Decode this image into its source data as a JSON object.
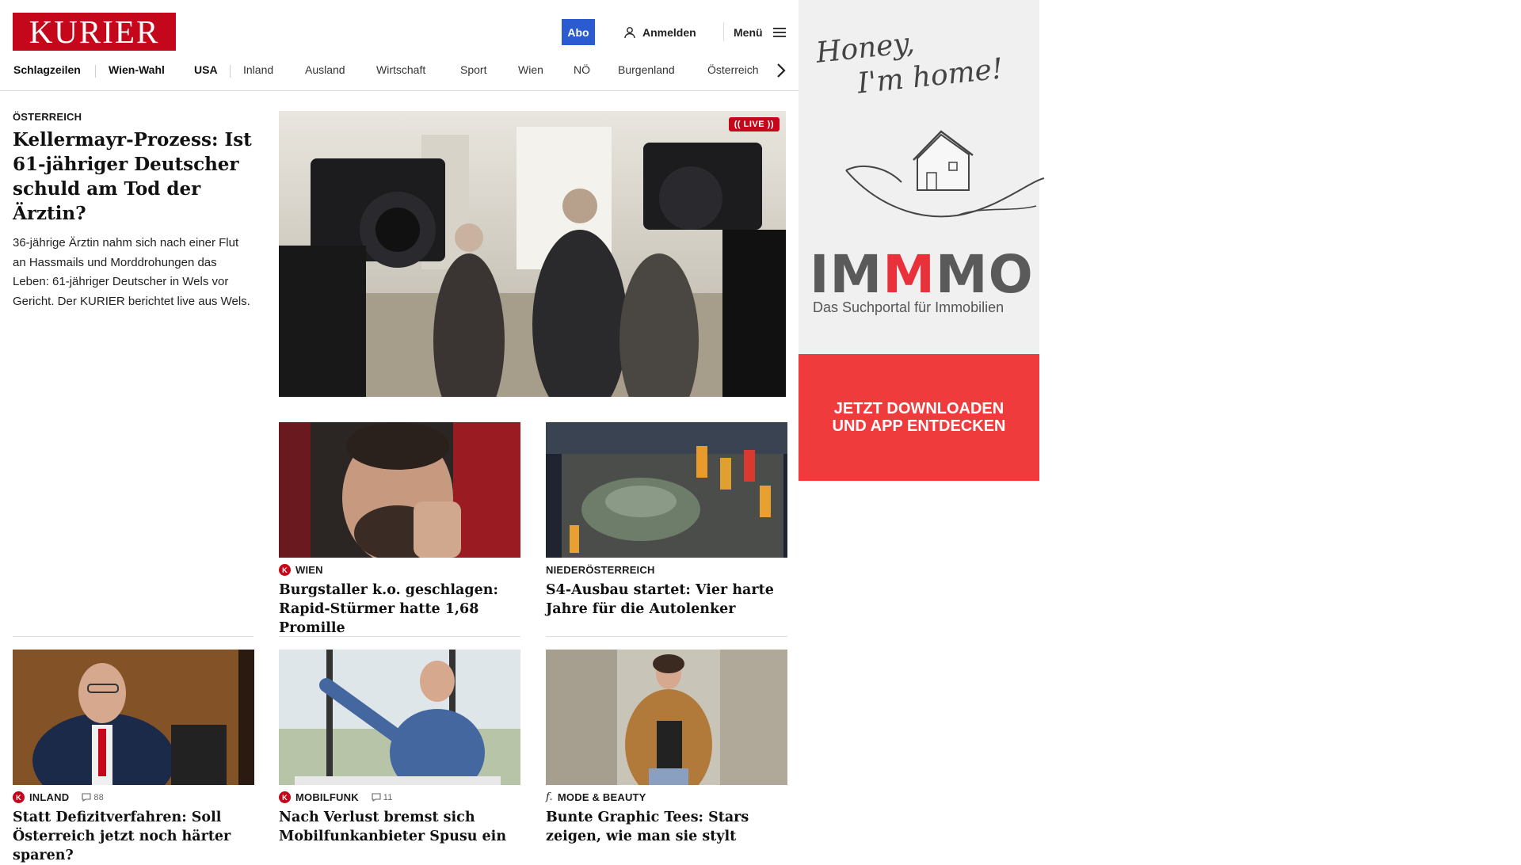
{
  "header": {
    "logo": "KURIER",
    "abo_label": "Abo",
    "login_label": "Anmelden",
    "menu_label": "Menü"
  },
  "nav": {
    "items": [
      "Schlagzeilen",
      "Wien-Wahl",
      "USA",
      "Inland",
      "Ausland",
      "Wirtschaft",
      "Sport",
      "Wien",
      "NÖ",
      "Burgenland",
      "Österreich"
    ]
  },
  "lead": {
    "kicker": "ÖSTERREICH",
    "headline": "Kellermayr-Prozess: Ist 61-jähriger Deutscher schuld am Tod der Ärztin?",
    "teaser": "36-jährige Ärztin nahm sich nach einer Flut an Hassmails und Morddrohungen das Leben: 61-jähriger Deutscher in Wels vor Gericht. Der KURIER berichtet live aus Wels.",
    "live_label": "LIVE"
  },
  "cards": [
    {
      "kicker": "WIEN",
      "headline": "Burgstaller k.o. geschlagen: Rapid-Stürmer hatte 1,68 Promille"
    },
    {
      "kicker": "NIEDERÖSTERREICH",
      "headline": "S4-Ausbau startet: Vier harte Jahre für die Autolenker"
    },
    {
      "kicker": "INLAND",
      "comments": "88",
      "headline": "Statt Defizitverfahren: Soll Österreich jetzt noch härter sparen?"
    },
    {
      "kicker": "MOBILFUNK",
      "comments": "11",
      "headline": "Nach Verlust bremst sich Mobilfunkanbieter Spusu ein"
    },
    {
      "kicker": "MODE & BEAUTY",
      "headline": "Bunte Graphic Tees: Stars zeigen, wie man sie stylt"
    }
  ],
  "ad": {
    "script_line1": "Honey,",
    "script_line2": "I'm home!",
    "brand_a": "IM",
    "brand_b": "M",
    "brand_c": "MO",
    "subtitle": "Das Suchportal für Immobilien",
    "cta_line1": "JETZT DOWNLOADEN",
    "cta_line2": "UND APP ENTDECKEN"
  },
  "colors": {
    "brand_red": "#c4071b",
    "abo_blue": "#2b5bd1",
    "ad_red": "#ef3b3b"
  }
}
